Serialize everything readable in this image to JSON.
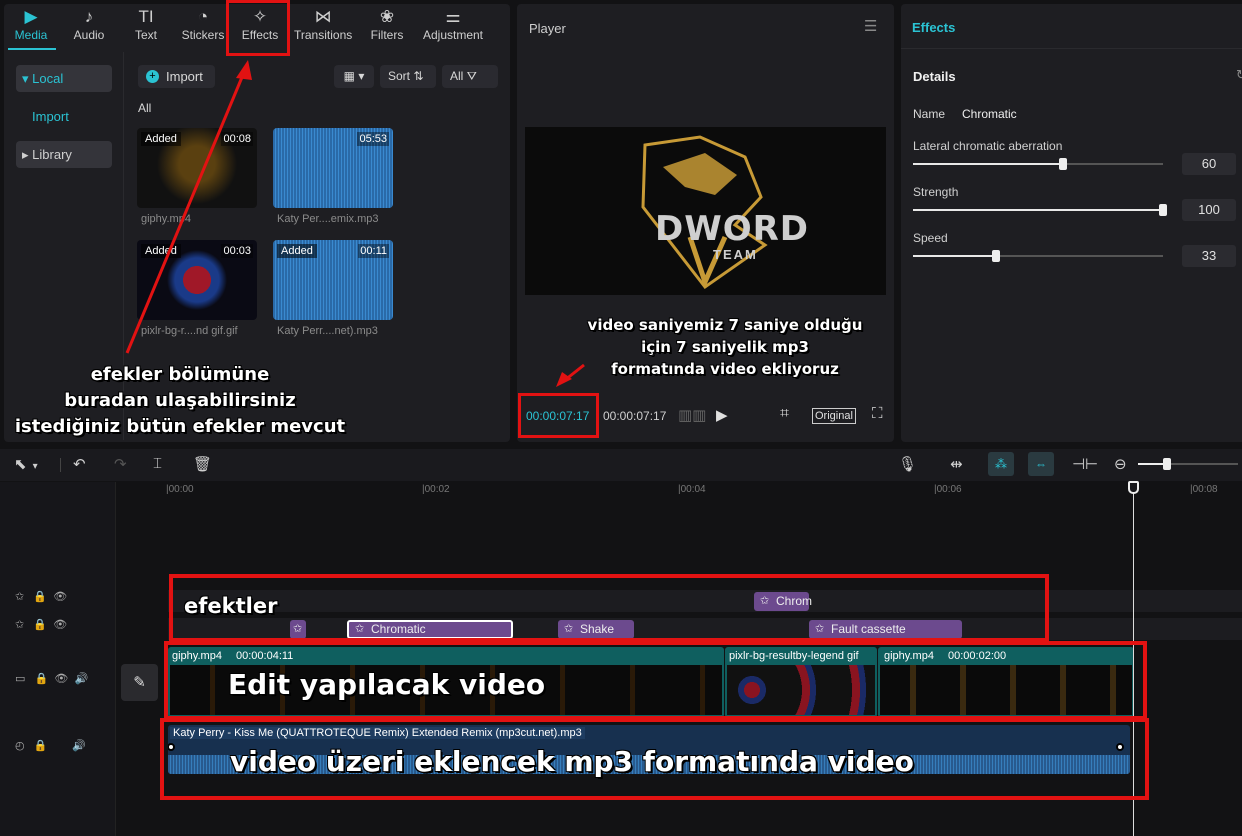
{
  "toolbar_tabs": [
    {
      "label": "Media",
      "icon": "media-icon",
      "glyph": "▶"
    },
    {
      "label": "Audio",
      "icon": "audio-icon",
      "glyph": "♪"
    },
    {
      "label": "Text",
      "icon": "text-icon",
      "glyph": "TI"
    },
    {
      "label": "Stickers",
      "icon": "stickers-icon",
      "glyph": "◔"
    },
    {
      "label": "Effects",
      "icon": "effects-icon",
      "glyph": "✧"
    },
    {
      "label": "Transitions",
      "icon": "transitions-icon",
      "glyph": "⋈"
    },
    {
      "label": "Filters",
      "icon": "filters-icon",
      "glyph": "❀"
    },
    {
      "label": "Adjustment",
      "icon": "adjustment-icon",
      "glyph": "⚌"
    }
  ],
  "media_sidebar": {
    "local": "Local",
    "import": "Import",
    "library": "Library"
  },
  "media_toolbar": {
    "import": "Import",
    "sort": "Sort",
    "all": "All"
  },
  "media_section": "All",
  "media_items": [
    {
      "name": "giphy.mp4",
      "badge": "Added",
      "duration": "00:08",
      "kind": "video"
    },
    {
      "name": "Katy Per....emix.mp3",
      "badge": "",
      "duration": "05:53",
      "kind": "audio"
    },
    {
      "name": "pixlr-bg-r....nd gif.gif",
      "badge": "Added",
      "duration": "00:03",
      "kind": "video"
    },
    {
      "name": "Katy Perr....net).mp3",
      "badge": "Added",
      "duration": "00:11",
      "kind": "audio"
    }
  ],
  "player": {
    "title": "Player",
    "current_time": "00:00:07:17",
    "total_time": "00:00:07:17",
    "original_label": "Original",
    "logo_main": "DWORD",
    "logo_sub": "TEAM"
  },
  "effects_panel": {
    "title": "Effects",
    "section": "Details",
    "name_label": "Name",
    "name_value": "Chromatic",
    "params": [
      {
        "label": "Lateral chromatic aberration",
        "value": "60",
        "level": 0.6
      },
      {
        "label": "Strength",
        "value": "100",
        "level": 1.0
      },
      {
        "label": "Speed",
        "value": "33",
        "level": 0.33
      }
    ]
  },
  "ruler": [
    "|00:00",
    "|00:02",
    "|00:04",
    "|00:06",
    "|00:08"
  ],
  "timeline": {
    "fx_row1": [
      {
        "label": "Chrom"
      }
    ],
    "fx_row2": [
      {
        "label": ""
      },
      {
        "label": "Chromatic"
      },
      {
        "label": "Shake"
      },
      {
        "label": "Fault cassette"
      }
    ],
    "video_clips": [
      {
        "name": "giphy.mp4",
        "duration": "00:00:04:11"
      },
      {
        "name": "pixlr-bg-resultby-legend gif",
        "duration": ""
      },
      {
        "name": "giphy.mp4",
        "duration": "00:00:02:00"
      }
    ],
    "audio_clip": "Katy Perry - Kiss Me (QUATTROTEQUE Remix) Extended Remix (mp3cut.net).mp3"
  },
  "annotations": {
    "effects_note": [
      "efekler bölümüne",
      "buradan ulaşabilirsiniz",
      "istediğiniz bütün efekler mevcut"
    ],
    "player_note": [
      "video saniyemiz 7 saniye olduğu",
      "için 7 saniyelik mp3",
      "formatında video ekliyoruz"
    ],
    "fx_track": "efektler",
    "video_track": "Edit yapılacak video",
    "audio_track": "video üzeri eklencek mp3 formatında video"
  },
  "colors": {
    "accent": "#2bc3d3",
    "highlight": "#e21212",
    "effect_clip": "#6c4a8e",
    "video_track": "#0f5f5f",
    "audio_track": "#2a5f95"
  }
}
